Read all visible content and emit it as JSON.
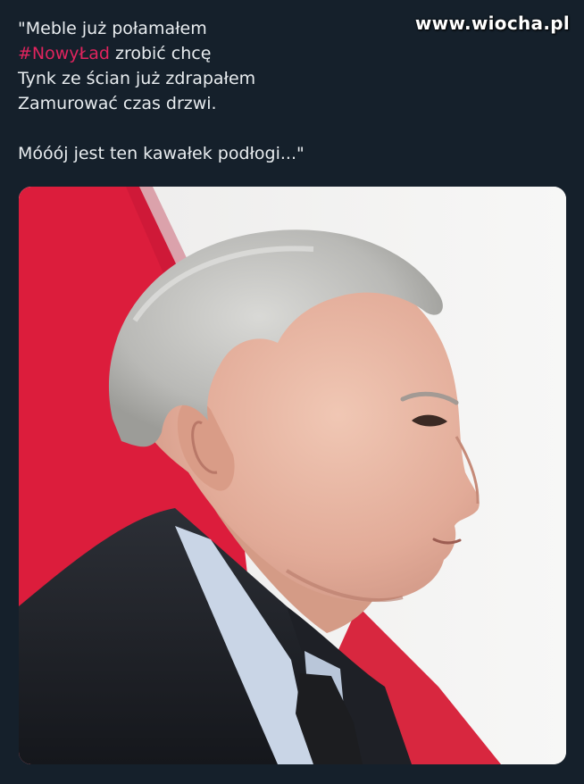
{
  "watermark": "www.wiocha.pl",
  "tweet": {
    "line1": "\"Meble już połamałem",
    "line2_hashtag": "#NowyŁad",
    "line2_rest": " zrobić chcę",
    "line3": "Tynk ze ścian już zdrapałem",
    "line4": "Zamurować czas drzwi.",
    "line5": "Móóój jest ten kawałek podłogi...\""
  },
  "media": {
    "flag_colors": {
      "white": "#f4f4f2",
      "red": "#dc143c"
    },
    "description_icon": "portrait-photo"
  }
}
